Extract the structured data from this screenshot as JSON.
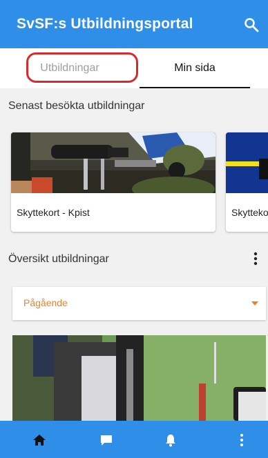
{
  "app": {
    "title": "SvSF:s Utbildningsportal"
  },
  "tabs": [
    {
      "label": "Utbildningar"
    },
    {
      "label": "Min sida"
    }
  ],
  "recent": {
    "title": "Senast besökta utbildningar",
    "cards": [
      {
        "label": "Skyttekort - Kpist"
      },
      {
        "label": "Skyttekort"
      }
    ]
  },
  "overview": {
    "title": "Översikt utbildningar",
    "filter_value": "Pågående"
  },
  "icons": {
    "search": "search-icon",
    "more": "more-vertical-icon",
    "home": "home-icon",
    "chat": "chat-icon",
    "bell": "bell-icon"
  },
  "colors": {
    "primary": "#2f8fe8",
    "accent": "#e8832a",
    "highlight": "#d62a2f"
  }
}
